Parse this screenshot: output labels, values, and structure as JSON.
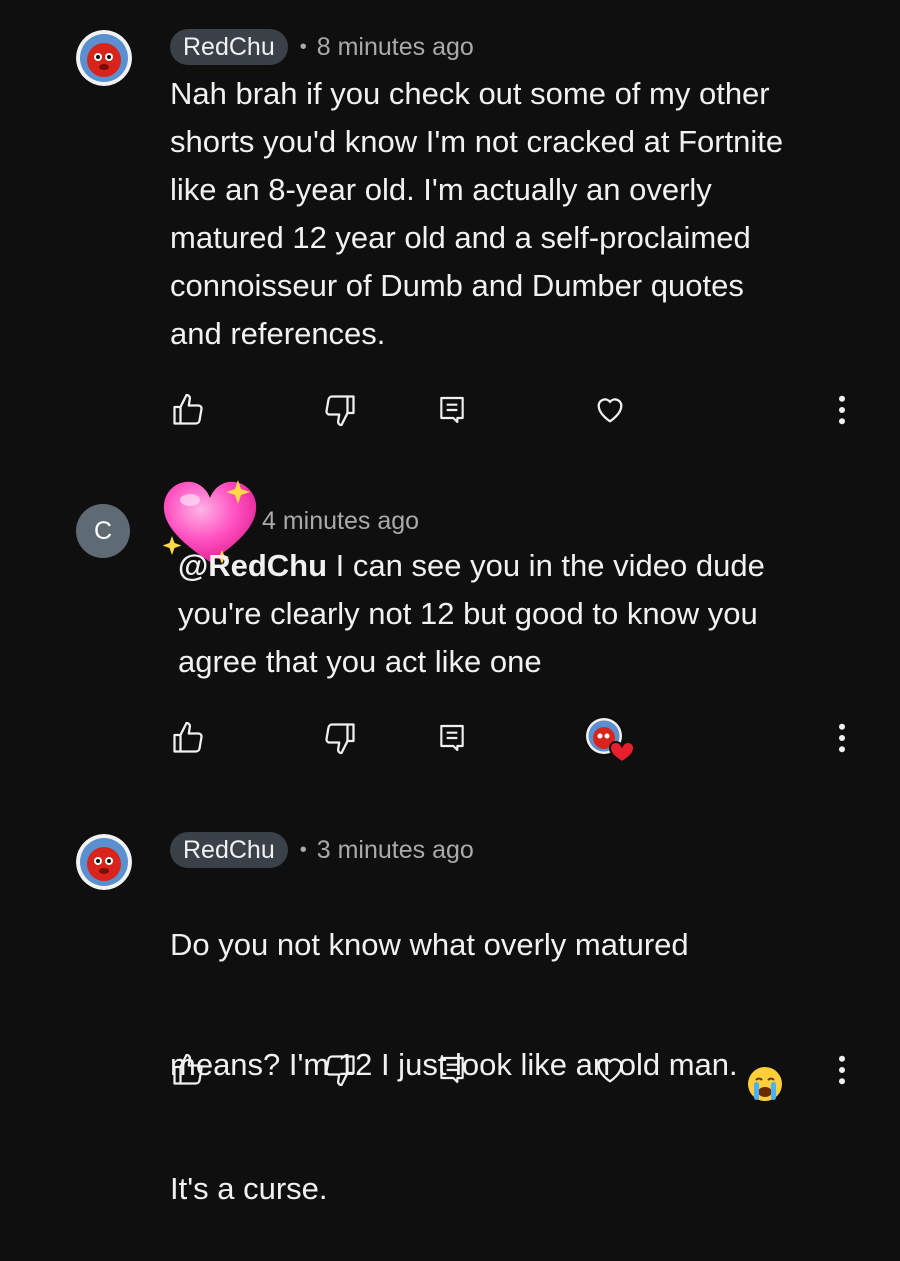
{
  "comments": [
    {
      "author": "RedChu",
      "dot": "•",
      "time": "8 minutes ago",
      "text": "Nah brah if you check out some of my other\nshorts you'd know I'm not cracked at Fortnite\nlike an 8-year old. I'm actually an overly\nmatured 12 year old and a self-proclaimed\nconnoisseur of Dumb and Dumber quotes\nand references."
    },
    {
      "avatar_letter": "C",
      "time": "4 minutes ago",
      "mention": "@RedChu",
      "text": "  I can see you in the video dude\nyou're clearly not 12 but good to know you\nagree that you act like one"
    },
    {
      "author": "RedChu",
      "dot": "•",
      "time": "3 minutes ago",
      "text_line1": "Do you not know what overly matured",
      "text_line2": "means? I'm 12 I just look like an old man.",
      "text_line3": "It's a curse."
    }
  ],
  "icons": [
    "thumbs-up-icon",
    "thumbs-down-icon",
    "reply-icon",
    "heart-icon",
    "more-vertical-icon",
    "crying-face-emoji",
    "sparkling-heart-emoji"
  ],
  "colors": {
    "background": "#0f0f0f",
    "text": "#f1f1f1",
    "muted": "#aaaaaa",
    "chip": "#3b4148",
    "avatar_red": "#d9241b",
    "avatar_blue": "#5a8fd0",
    "heart_red": "#e8202e"
  }
}
